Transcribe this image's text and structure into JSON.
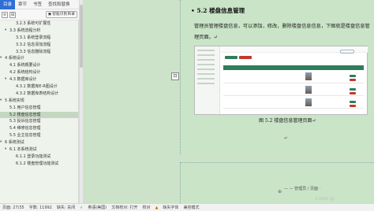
{
  "nav_tabs": [
    {
      "label": "目录",
      "active": true
    },
    {
      "label": "章节",
      "active": false
    },
    {
      "label": "书签",
      "active": false
    },
    {
      "label": "查找和替换",
      "active": false
    }
  ],
  "toolbar": {
    "smart_toc_label": "智能识别目录"
  },
  "nav_items": [
    {
      "label": "3.2.3 系统可扩展性",
      "indent": 2,
      "caret": ""
    },
    {
      "label": "3.3 系统流程分析",
      "indent": 1,
      "caret": "▾"
    },
    {
      "label": "3.3.1 系统登录流程",
      "indent": 2,
      "caret": ""
    },
    {
      "label": "3.3.2 信息添加流程",
      "indent": 2,
      "caret": ""
    },
    {
      "label": "3.3.3 信息删除流程",
      "indent": 2,
      "caret": ""
    },
    {
      "label": "4 系统设计",
      "indent": 0,
      "caret": "▾"
    },
    {
      "label": "4.1 系统概要设计",
      "indent": 1,
      "caret": ""
    },
    {
      "label": "4.2 系统结构设计",
      "indent": 1,
      "caret": ""
    },
    {
      "label": "4.3 数据库设计",
      "indent": 1,
      "caret": "▾"
    },
    {
      "label": "4.3.1 数据库E-R图设计",
      "indent": 2,
      "caret": ""
    },
    {
      "label": "4.3.2 数据库表结构设计",
      "indent": 2,
      "caret": ""
    },
    {
      "label": "5 系统实现",
      "indent": 0,
      "caret": "▾"
    },
    {
      "label": "5.1 用户信息管理",
      "indent": 1,
      "caret": ""
    },
    {
      "label": "5.2 楼盘信息管理",
      "indent": 1,
      "caret": "",
      "active": true
    },
    {
      "label": "5.3 投诉信息管理",
      "indent": 1,
      "caret": ""
    },
    {
      "label": "5.4 维修信息管理",
      "indent": 1,
      "caret": ""
    },
    {
      "label": "5.5 业主信息管理",
      "indent": 1,
      "caret": ""
    },
    {
      "label": "6 系统测试",
      "indent": 0,
      "caret": "▾"
    },
    {
      "label": "6.1 本系统测试",
      "indent": 1,
      "caret": "▾"
    },
    {
      "label": "6.1.1 登录功能测试",
      "indent": 2,
      "caret": ""
    },
    {
      "label": "6.1.2 楼盘管理功能测试",
      "indent": 2,
      "caret": ""
    }
  ],
  "document": {
    "heading": "• 5.2  楼盘信息管理",
    "paragraph": "管理员管理楼盘信息，可以添加，修改，删除楼盘信息信息，下图就是楼盘信息管理页面。↵",
    "caption": "图 5.2 楼盘信息管理页面↵",
    "footer_mark": "— — 管理员 / 页面 ·"
  },
  "status_bar": {
    "page": "页面: 27/35",
    "words": "字数: 11992",
    "spell": "拼写检查: 打开",
    "proof": "校对",
    "missing_font": "缺失字体",
    "reading_mode": "兼容模式"
  },
  "status_extra": {
    "lang": "英语(美国)",
    "inspect": "文档校对: 打开",
    "office_mode": "缺失: 关闭"
  },
  "watermark": "CSDN @...",
  "colors": {
    "accent": "#2f6fd6",
    "page_bg": "#c9e4c7",
    "fig_green": "#2e7d5b"
  }
}
